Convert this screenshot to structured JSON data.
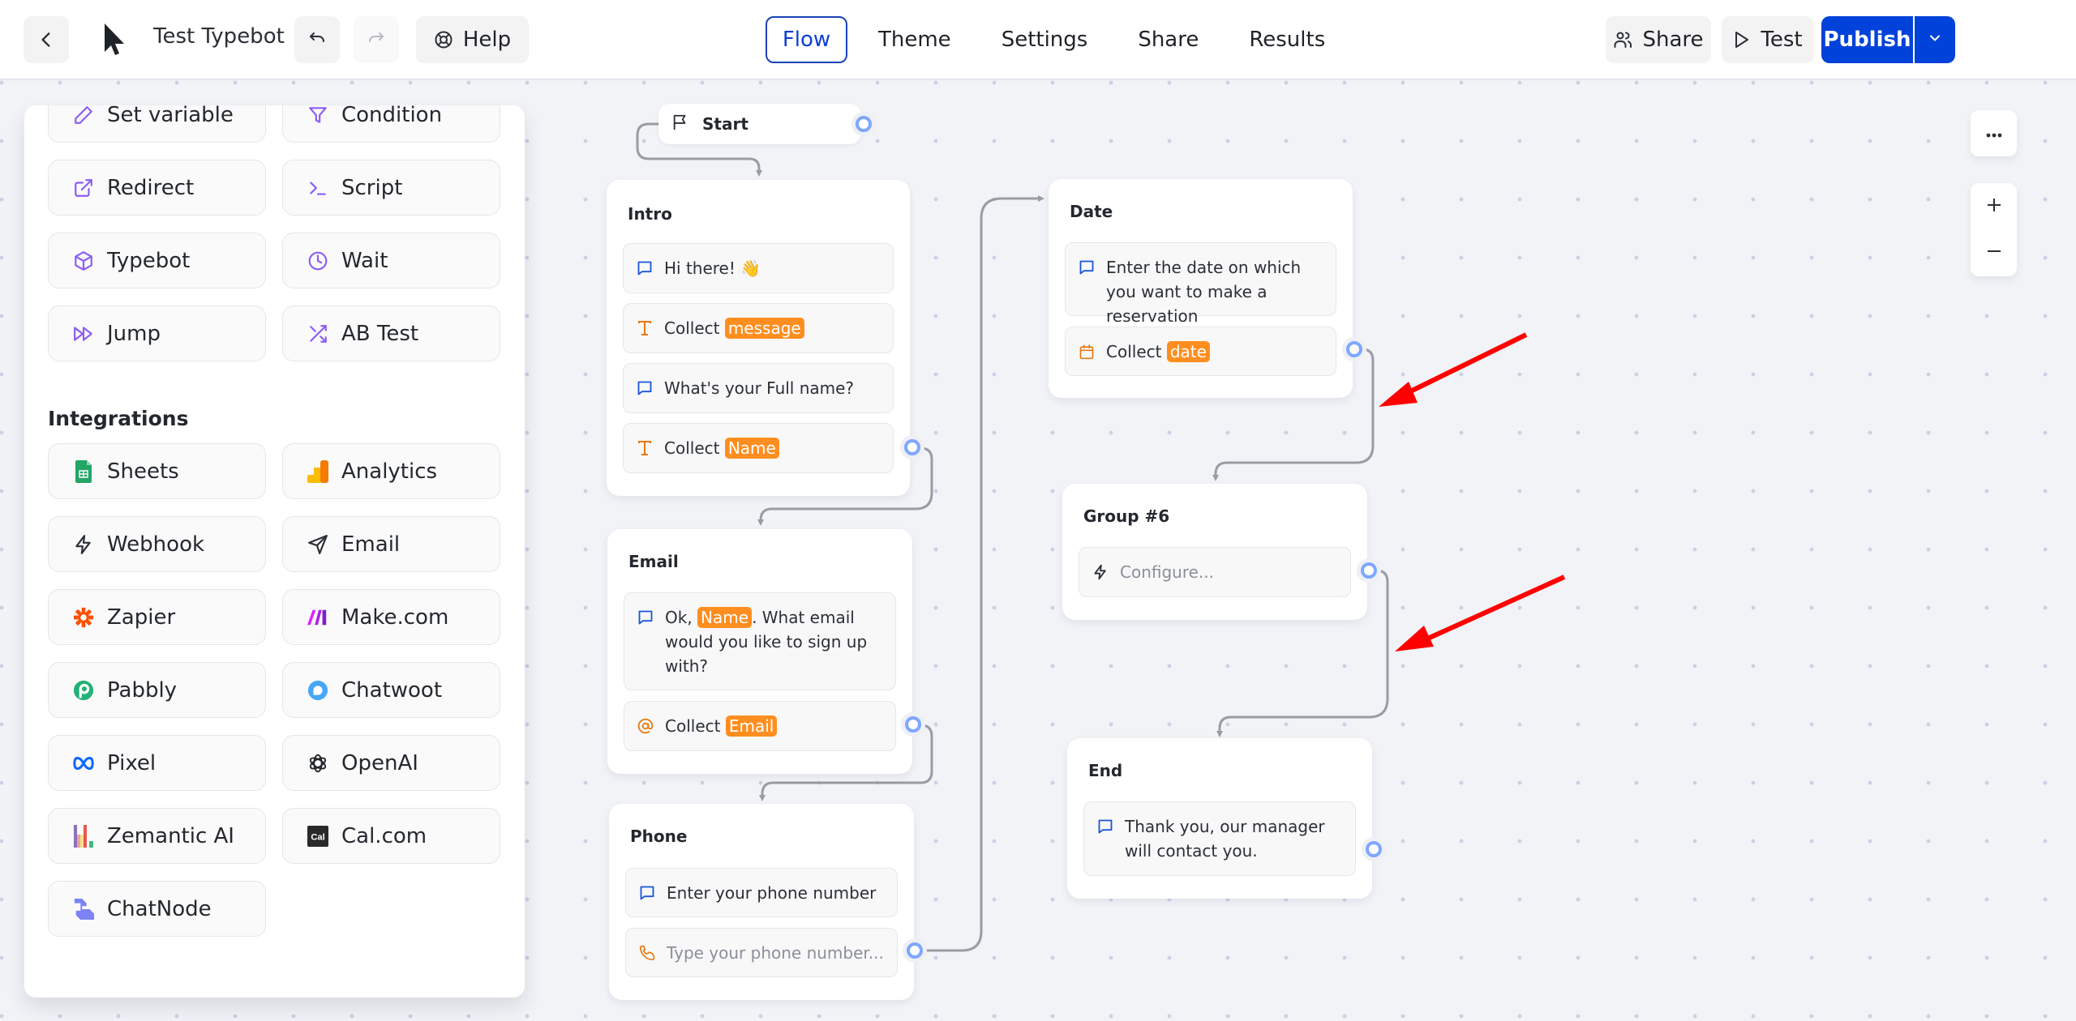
{
  "header": {
    "back_icon": "chevron-left-icon",
    "logo_icon": "cursor-arrow-logo-icon",
    "title": "Test Typebot",
    "undo_icon": "undo-icon",
    "redo_icon": "redo-icon",
    "help_label": "Help",
    "help_icon": "lifebuoy-icon",
    "tabs": [
      {
        "label": "Flow",
        "active": true
      },
      {
        "label": "Theme",
        "active": false
      },
      {
        "label": "Settings",
        "active": false
      },
      {
        "label": "Share",
        "active": false
      },
      {
        "label": "Results",
        "active": false
      }
    ],
    "share_label": "Share",
    "test_label": "Test",
    "publish_label": "Publish",
    "accent_color": "#0042da"
  },
  "sidebar": {
    "logic_items": [
      {
        "label": "Set variable",
        "icon": "pencil-icon"
      },
      {
        "label": "Condition",
        "icon": "filter-icon"
      },
      {
        "label": "Redirect",
        "icon": "external-link-icon"
      },
      {
        "label": "Script",
        "icon": "terminal-icon"
      },
      {
        "label": "Typebot",
        "icon": "cube-icon"
      },
      {
        "label": "Wait",
        "icon": "clock-icon"
      },
      {
        "label": "Jump",
        "icon": "fast-forward-icon"
      },
      {
        "label": "AB Test",
        "icon": "shuffle-icon"
      }
    ],
    "integrations_heading": "Integrations",
    "integration_items": [
      {
        "label": "Sheets",
        "icon": "google-sheets-icon"
      },
      {
        "label": "Analytics",
        "icon": "google-analytics-icon"
      },
      {
        "label": "Webhook",
        "icon": "lightning-icon"
      },
      {
        "label": "Email",
        "icon": "send-icon"
      },
      {
        "label": "Zapier",
        "icon": "zapier-icon"
      },
      {
        "label": "Make.com",
        "icon": "make-icon"
      },
      {
        "label": "Pabbly",
        "icon": "pabbly-icon"
      },
      {
        "label": "Chatwoot",
        "icon": "chatwoot-icon"
      },
      {
        "label": "Pixel",
        "icon": "meta-icon"
      },
      {
        "label": "OpenAI",
        "icon": "openai-icon"
      },
      {
        "label": "Zemantic AI",
        "icon": "zemantic-icon"
      },
      {
        "label": "Cal.com",
        "icon": "calcom-icon"
      },
      {
        "label": "ChatNode",
        "icon": "chatnode-icon"
      }
    ]
  },
  "flow": {
    "start": {
      "label": "Start"
    },
    "groups": {
      "intro": {
        "title": "Intro",
        "blocks": [
          {
            "type": "text-bubble",
            "text": "Hi there! 👋"
          },
          {
            "type": "text-input",
            "prefix": "Collect",
            "variable": "message"
          },
          {
            "type": "text-bubble",
            "text": "What's your Full name?"
          },
          {
            "type": "text-input",
            "prefix": "Collect",
            "variable": "Name"
          }
        ]
      },
      "email": {
        "title": "Email",
        "blocks": [
          {
            "type": "text-bubble",
            "text_before": "Ok, ",
            "variable": "Name",
            "text_after": ". What email would you like to sign up with?"
          },
          {
            "type": "email-input",
            "prefix": "Collect",
            "variable": "Email"
          }
        ]
      },
      "phone": {
        "title": "Phone",
        "blocks": [
          {
            "type": "text-bubble",
            "text": "Enter your phone number"
          },
          {
            "type": "phone-input",
            "placeholder": "Type your phone number..."
          }
        ]
      },
      "date": {
        "title": "Date",
        "blocks": [
          {
            "type": "text-bubble",
            "text": "Enter the date on which you want to make a reservation"
          },
          {
            "type": "date-input",
            "prefix": "Collect",
            "variable": "date"
          }
        ]
      },
      "group6": {
        "title": "Group #6",
        "blocks": [
          {
            "type": "webhook",
            "placeholder": "Configure..."
          }
        ]
      },
      "end": {
        "title": "End",
        "blocks": [
          {
            "type": "text-bubble",
            "text": "Thank you, our manager will contact you."
          }
        ]
      }
    },
    "variable_color": "#ff8e20",
    "annotation_color": "#ff0000"
  },
  "controls": {
    "more_icon": "more-horizontal-icon",
    "zoom_in_icon": "plus-icon",
    "zoom_out_icon": "minus-icon"
  }
}
